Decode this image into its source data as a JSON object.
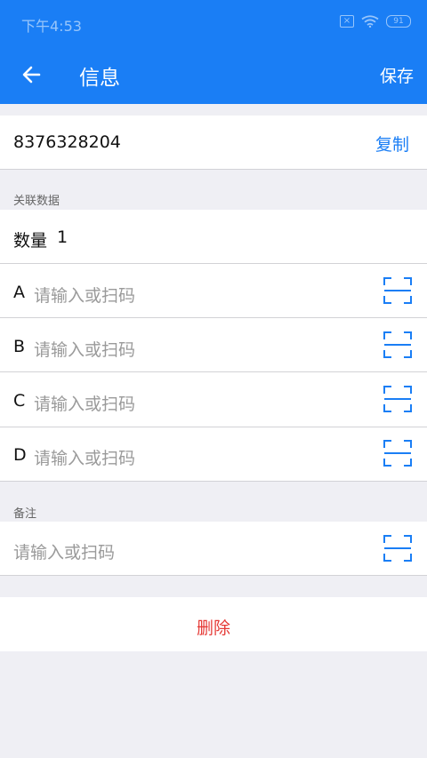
{
  "status_bar": {
    "time": "下午4:53",
    "close_glyph": "×",
    "battery": "91",
    "icons": [
      "close-box-icon",
      "wifi-icon",
      "battery-icon"
    ]
  },
  "app_bar": {
    "title": "信息",
    "save_label": "保存",
    "back_icon": "arrow-left-icon",
    "background": "#1a7ef5"
  },
  "code": {
    "value": "8376328204",
    "copy_label": "复制"
  },
  "related": {
    "section_label": "关联数据",
    "quantity_label": "数量",
    "quantity_value": "1",
    "fields": [
      {
        "letter": "A",
        "placeholder": "请输入或扫码",
        "icon": "scan-icon"
      },
      {
        "letter": "B",
        "placeholder": "请输入或扫码",
        "icon": "scan-icon"
      },
      {
        "letter": "C",
        "placeholder": "请输入或扫码",
        "icon": "scan-icon"
      },
      {
        "letter": "D",
        "placeholder": "请输入或扫码",
        "icon": "scan-icon"
      }
    ]
  },
  "remark": {
    "section_label": "备注",
    "placeholder": "请输入或扫码",
    "icon": "scan-icon"
  },
  "delete_label": "删除",
  "colors": {
    "accent": "#1a7ef5",
    "danger": "#e53935",
    "background": "#efeff4"
  }
}
